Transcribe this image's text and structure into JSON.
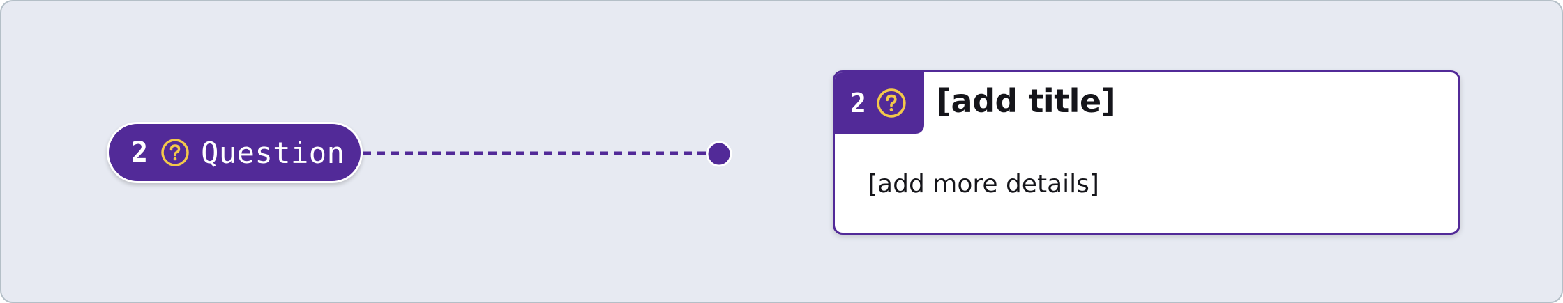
{
  "node": {
    "number": "2",
    "icon": "question-circle-icon",
    "label": "Question"
  },
  "card": {
    "number": "2",
    "icon": "question-circle-icon",
    "title": "[add title]",
    "details": "[add more details]"
  },
  "colors": {
    "primary": "#522a98",
    "accent": "#f3c84a",
    "background": "#e7eaf2",
    "border": "#b4bfc7",
    "text": "#15151a"
  }
}
